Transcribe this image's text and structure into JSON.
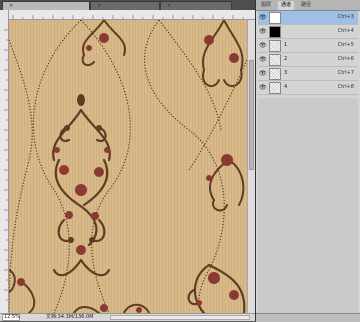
{
  "document_tabs": [
    {
      "label": "",
      "active": true
    },
    {
      "label": "",
      "active": false
    },
    {
      "label": "",
      "active": false
    }
  ],
  "status": {
    "zoom": "12.5%",
    "doc_info": "文档:34.3M/136.0M"
  },
  "panel_tabs": [
    "图层",
    "通道",
    "路径"
  ],
  "channels": [
    {
      "name": "",
      "shortcut": "Ctrl+3",
      "thumb": "white",
      "selected": true
    },
    {
      "name": "",
      "shortcut": "Ctrl+4",
      "thumb": "black",
      "selected": false
    },
    {
      "name": "1",
      "shortcut": "Ctrl+5",
      "thumb": "noise",
      "selected": false
    },
    {
      "name": "2",
      "shortcut": "Ctrl+6",
      "thumb": "noise",
      "selected": false
    },
    {
      "name": "3",
      "shortcut": "Ctrl+7",
      "thumb": "noise",
      "selected": false
    },
    {
      "name": "4",
      "shortcut": "Ctrl+8",
      "thumb": "noise",
      "selected": false
    }
  ],
  "colors": {
    "canvas_bg": "#d7b887",
    "ornament_brown": "#5e3d22",
    "flower_red": "#8a3a30",
    "dotted_line": "#5a3a22",
    "selection": "#9fbfe6"
  }
}
